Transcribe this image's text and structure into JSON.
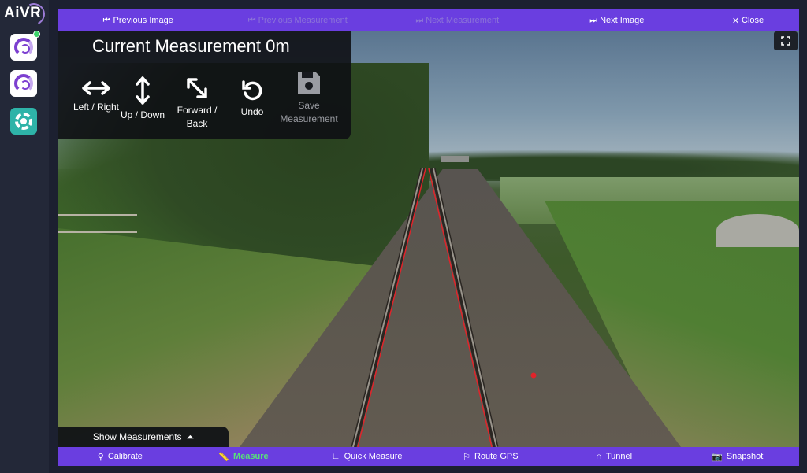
{
  "app": {
    "logo_text": "AiVR"
  },
  "rail": {
    "items": [
      {
        "icon": "aivr-swirl-icon",
        "status": "online"
      },
      {
        "icon": "aivr-swirl-icon"
      },
      {
        "icon": "settings-gear-icon"
      }
    ]
  },
  "topbar": {
    "previous_image": "Previous Image",
    "previous_measurement": "Previous Measurement",
    "next_measurement": "Next Measurement",
    "next_image": "Next Image",
    "close": "Close"
  },
  "measurement": {
    "title": "Current Measurement 0m",
    "tools": {
      "left_right": "Left / Right",
      "up_down": "Up / Down",
      "forward_back_1": "Forward /",
      "forward_back_2": "Back",
      "undo": "Undo",
      "save_1": "Save",
      "save_2": "Measurement"
    }
  },
  "show_measurements": "Show Measurements",
  "bottombar": {
    "calibrate": "Calibrate",
    "measure": "Measure",
    "quick_measure": "Quick Measure",
    "route_gps": "Route GPS",
    "tunnel": "Tunnel",
    "snapshot": "Snapshot"
  },
  "colors": {
    "toolbar": "#6a3ee0",
    "active_tool": "#58e07a",
    "rail_line": "#e0242a"
  }
}
